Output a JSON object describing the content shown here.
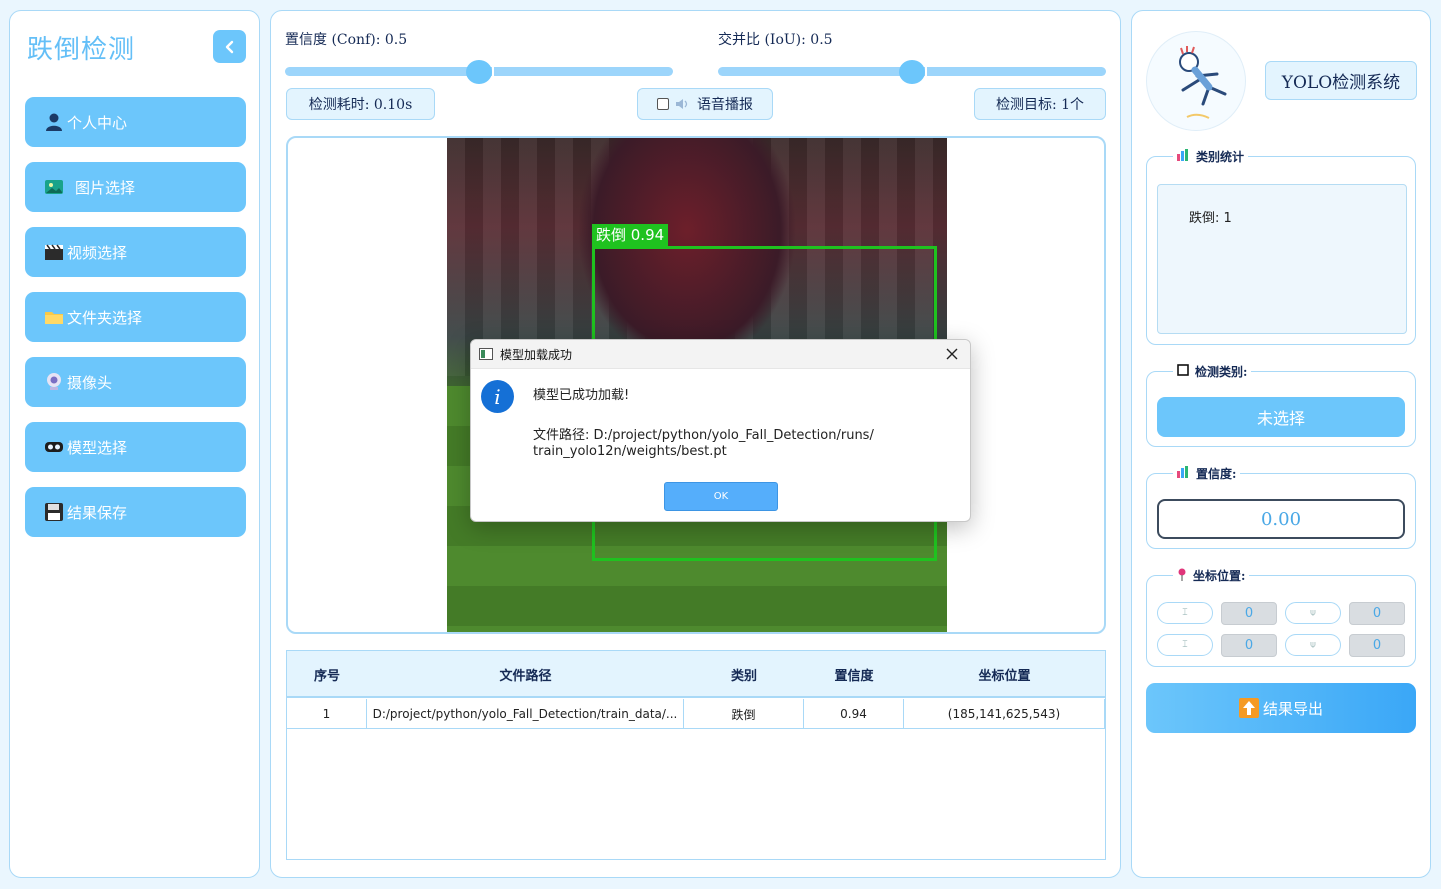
{
  "sidebar": {
    "title": "跌倒检测",
    "items": [
      {
        "label": "个人中心",
        "icon": "user-icon"
      },
      {
        "label": "图片选择",
        "icon": "image-icon"
      },
      {
        "label": "视频选择",
        "icon": "clapper-icon"
      },
      {
        "label": "文件夹选择",
        "icon": "folder-icon"
      },
      {
        "label": "摄像头",
        "icon": "webcam-icon"
      },
      {
        "label": "模型选择",
        "icon": "vr-model-icon"
      },
      {
        "label": "结果保存",
        "icon": "floppy-disk-icon"
      }
    ]
  },
  "controls": {
    "conf_label": "置信度 (Conf): 0.5",
    "conf_value": 0.5,
    "iou_label": "交并比 (IoU): 0.5",
    "iou_value": 0.5,
    "time_label": "检测耗时: 0.10s",
    "voice_label": "语音播报",
    "voice_checked": false,
    "targets_label": "检测目标: 1个"
  },
  "detection": {
    "label": "跌倒 0.94",
    "box_color": "#1fc21f"
  },
  "table": {
    "headers": [
      "序号",
      "文件路径",
      "类别",
      "置信度",
      "坐标位置"
    ],
    "rows": [
      {
        "index": "1",
        "path": "D:/project/python/yolo_Fall_Detection/train_data/...",
        "class": "跌倒",
        "confidence": "0.94",
        "coords": "(185,141,625,543)"
      }
    ]
  },
  "right": {
    "system_title": "YOLO检测系统",
    "stats_title": "类别统计",
    "stats_text": "跌倒: 1",
    "class_title": "检测类别:",
    "class_value": "未选择",
    "conf_title": "置信度:",
    "conf_value": "0.00",
    "coords_title": "坐标位置:",
    "coords": {
      "xmin": "0",
      "ymin": "0",
      "xmax": "0",
      "ymax": "0"
    },
    "export_label": "结果导出"
  },
  "dialog": {
    "title": "模型加载成功",
    "message": "模型已成功加载!",
    "path_line1": "文件路径: D:/project/python/yolo_Fall_Detection/runs/",
    "path_line2": "train_yolo12n/weights/best.pt",
    "ok_label": "OK"
  },
  "colors": {
    "accent": "#6cc6fb",
    "border": "#a9d9f7",
    "background": "#eaf6fe"
  }
}
